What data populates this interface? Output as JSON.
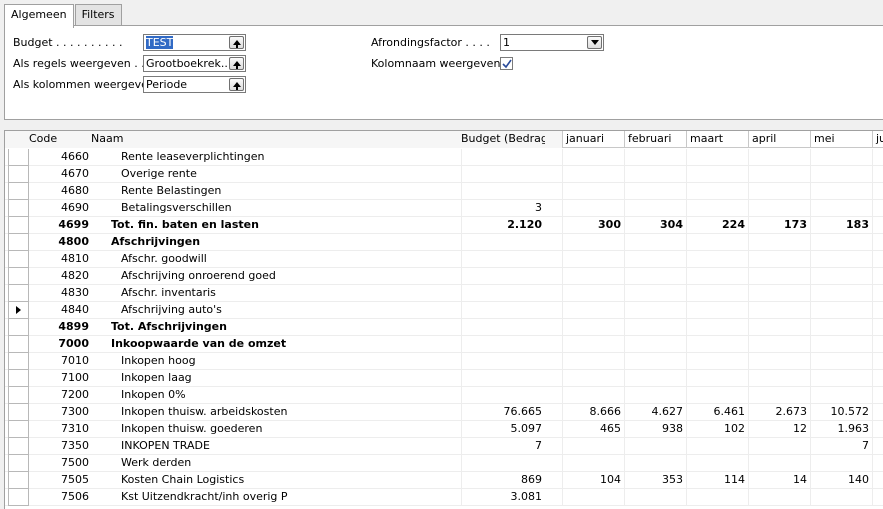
{
  "tabs": [
    {
      "label": "Algemeen",
      "active": true
    },
    {
      "label": "Filters",
      "active": false
    }
  ],
  "form": {
    "budget": {
      "label": "Budget . . . . . . . . . .",
      "value": "TEST"
    },
    "regels": {
      "label": "Als regels weergeven . .",
      "value": "Grootboekrek..."
    },
    "kolommen": {
      "label": "Als kolommen weergeven",
      "value": "Periode"
    },
    "afronding": {
      "label": "Afrondingsfactor . . . .",
      "value": "1"
    },
    "kolomnaam": {
      "label": "Kolomnaam weergeven .",
      "checked": true
    }
  },
  "grid": {
    "headers": {
      "code": "Code",
      "naam": "Naam",
      "budget": "Budget (Bedrag)"
    },
    "periods": [
      "januari",
      "februari",
      "maart",
      "april",
      "mei",
      "ju"
    ],
    "rows": [
      {
        "code": "4660",
        "name": "Rente leaseverplichtingen",
        "indent": 2,
        "bold": false,
        "budget": "",
        "p": [
          "",
          "",
          "",
          "",
          ""
        ]
      },
      {
        "code": "4670",
        "name": "Overige rente",
        "indent": 2,
        "bold": false,
        "budget": "",
        "p": [
          "",
          "",
          "",
          "",
          ""
        ]
      },
      {
        "code": "4680",
        "name": "Rente Belastingen",
        "indent": 2,
        "bold": false,
        "budget": "",
        "p": [
          "",
          "",
          "",
          "",
          ""
        ]
      },
      {
        "code": "4690",
        "name": "Betalingsverschillen",
        "indent": 2,
        "bold": false,
        "budget": "3",
        "p": [
          "",
          "",
          "",
          "",
          ""
        ]
      },
      {
        "code": "4699",
        "name": "Tot. fin. baten en lasten",
        "indent": 1,
        "bold": true,
        "budget": "2.120",
        "p": [
          "300",
          "304",
          "224",
          "173",
          "183"
        ]
      },
      {
        "code": "4800",
        "name": "Afschrijvingen",
        "indent": 1,
        "bold": true,
        "budget": "",
        "p": [
          "",
          "",
          "",
          "",
          ""
        ]
      },
      {
        "code": "4810",
        "name": "Afschr. goodwill",
        "indent": 2,
        "bold": false,
        "budget": "",
        "p": [
          "",
          "",
          "",
          "",
          ""
        ]
      },
      {
        "code": "4820",
        "name": "Afschrijving onroerend goed",
        "indent": 2,
        "bold": false,
        "budget": "",
        "p": [
          "",
          "",
          "",
          "",
          ""
        ]
      },
      {
        "code": "4830",
        "name": "Afschr. inventaris",
        "indent": 2,
        "bold": false,
        "budget": "",
        "p": [
          "",
          "",
          "",
          "",
          ""
        ]
      },
      {
        "code": "4840",
        "name": "Afschrijving auto's",
        "indent": 2,
        "bold": false,
        "budget": "",
        "p": [
          "",
          "",
          "",
          "",
          ""
        ],
        "current": true
      },
      {
        "code": "4899",
        "name": "Tot. Afschrijvingen",
        "indent": 1,
        "bold": true,
        "budget": "",
        "p": [
          "",
          "",
          "",
          "",
          ""
        ]
      },
      {
        "code": "7000",
        "name": "Inkoopwaarde van de omzet",
        "indent": 1,
        "bold": true,
        "budget": "",
        "p": [
          "",
          "",
          "",
          "",
          ""
        ]
      },
      {
        "code": "7010",
        "name": "Inkopen hoog",
        "indent": 2,
        "bold": false,
        "budget": "",
        "p": [
          "",
          "",
          "",
          "",
          ""
        ]
      },
      {
        "code": "7100",
        "name": "Inkopen laag",
        "indent": 2,
        "bold": false,
        "budget": "",
        "p": [
          "",
          "",
          "",
          "",
          ""
        ]
      },
      {
        "code": "7200",
        "name": "Inkopen 0%",
        "indent": 2,
        "bold": false,
        "budget": "",
        "p": [
          "",
          "",
          "",
          "",
          ""
        ]
      },
      {
        "code": "7300",
        "name": "Inkopen thuisw. arbeidskosten",
        "indent": 2,
        "bold": false,
        "budget": "76.665",
        "p": [
          "8.666",
          "4.627",
          "6.461",
          "2.673",
          "10.572"
        ]
      },
      {
        "code": "7310",
        "name": "Inkopen thuisw. goederen",
        "indent": 2,
        "bold": false,
        "budget": "5.097",
        "p": [
          "465",
          "938",
          "102",
          "12",
          "1.963"
        ]
      },
      {
        "code": "7350",
        "name": "INKOPEN TRADE",
        "indent": 2,
        "bold": false,
        "budget": "7",
        "p": [
          "",
          "",
          "",
          "",
          "7"
        ]
      },
      {
        "code": "7500",
        "name": "Werk derden",
        "indent": 2,
        "bold": false,
        "budget": "",
        "p": [
          "",
          "",
          "",
          "",
          ""
        ]
      },
      {
        "code": "7505",
        "name": "Kosten Chain Logistics",
        "indent": 2,
        "bold": false,
        "budget": "869",
        "p": [
          "104",
          "353",
          "114",
          "14",
          "140"
        ]
      },
      {
        "code": "7506",
        "name": "Kst Uitzendkracht/inh overig P",
        "indent": 2,
        "bold": false,
        "budget": "3.081",
        "p": [
          "",
          "",
          "",
          "",
          ""
        ]
      }
    ]
  }
}
